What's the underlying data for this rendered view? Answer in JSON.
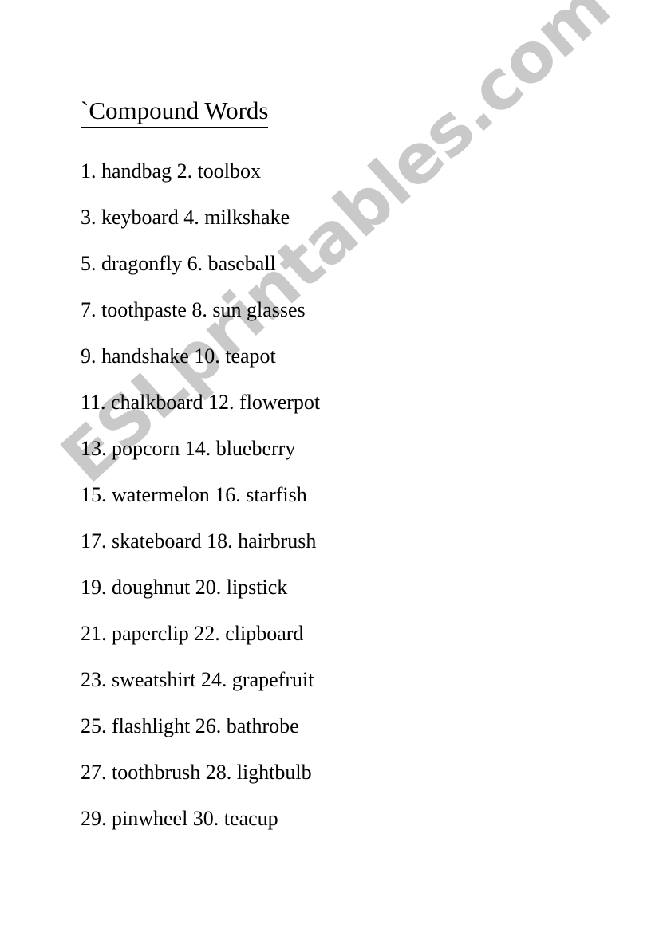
{
  "document": {
    "title": "`Compound Words",
    "lines": [
      "1. handbag 2. toolbox",
      "3. keyboard 4. milkshake",
      "5. dragonfly 6. baseball",
      "7. toothpaste 8. sun glasses",
      "9. handshake 10. teapot",
      "11. chalkboard 12. flowerpot",
      "13. popcorn 14. blueberry",
      "15. watermelon 16. starfish",
      "17. skateboard 18. hairbrush",
      "19. doughnut 20. lipstick",
      "21. paperclip 22. clipboard",
      "23. sweatshirt 24. grapefruit",
      "25. flashlight 26. bathrobe",
      "27. toothbrush 28. lightbulb",
      "29. pinwheel 30. teacup"
    ]
  },
  "watermark": {
    "text": "ESLprintables.com",
    "color": "#c9c9c9",
    "rotation_deg": -42
  },
  "colors": {
    "page_background": "#ffffff",
    "text": "#000000",
    "watermark": "#c9c9c9"
  }
}
